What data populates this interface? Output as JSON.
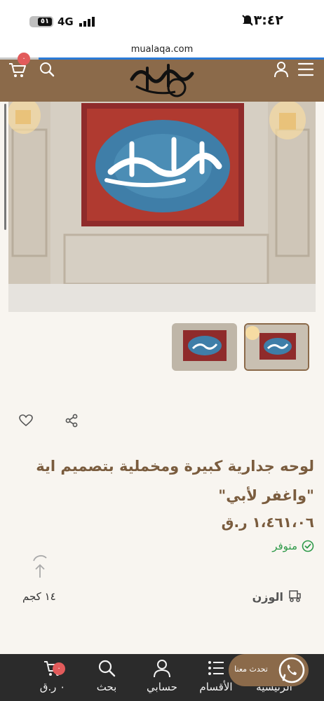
{
  "status_bar": {
    "time": "٣:٤٢",
    "network": "4G",
    "battery": "٥١"
  },
  "browser": {
    "url": "mualaqa.com"
  },
  "header": {
    "cart_count": "٠",
    "logo_text": "معلقة"
  },
  "gallery": {
    "artwork_text": "واغفر لأبي",
    "thumbnail_count": 2
  },
  "product": {
    "title": "لوحه جدارية كبيرة ومخملية بتصميم اية \"واغفر لأبي\"",
    "price": "١،٤٦١،٠٦ ر.ق",
    "stock_status": "متوفر",
    "weight_label": "الوزن",
    "weight_value": "١٤ كجم"
  },
  "bottom_nav": {
    "items": [
      {
        "label": "الرئيسية"
      },
      {
        "label": "الأقسام"
      },
      {
        "label": "حسابي"
      },
      {
        "label": "بحث"
      },
      {
        "label": "٠ ر.ق"
      }
    ],
    "cart_badge": "٠"
  },
  "whatsapp": {
    "label": "تحدث معنا"
  },
  "colors": {
    "brand": "#8b6a4a",
    "title_text": "#7a5c3e",
    "stock_green": "#2f9a4a",
    "badge_red": "#e25b5b",
    "nav_bg": "#2b2b2b"
  }
}
